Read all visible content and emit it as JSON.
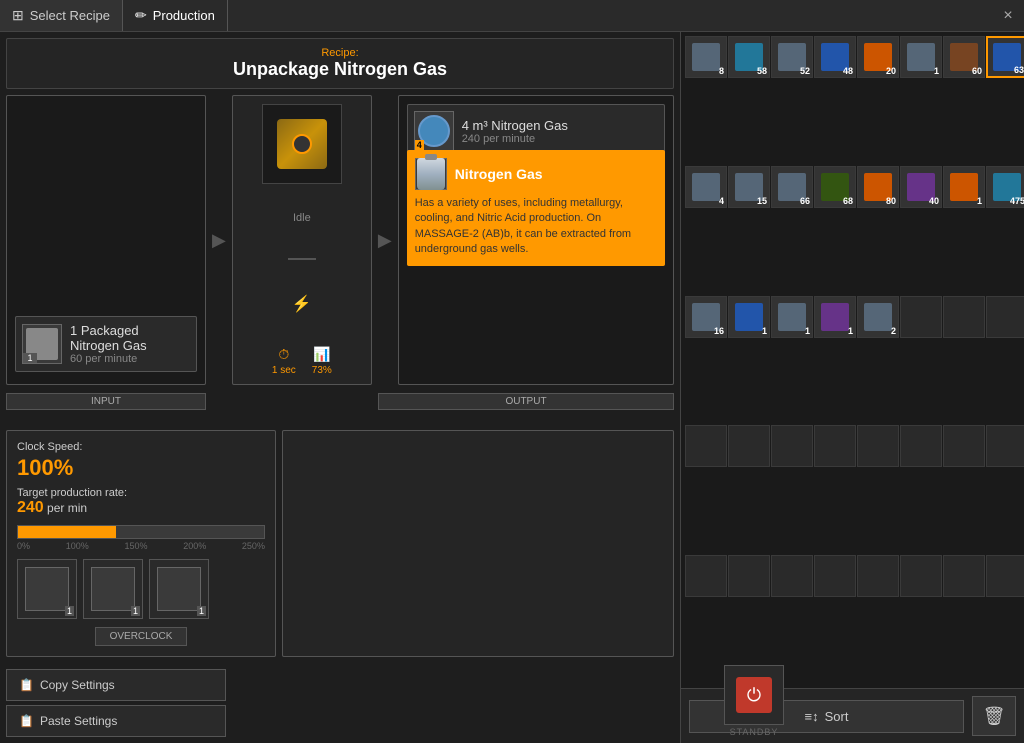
{
  "titlebar": {
    "tab1_label": "Select Recipe",
    "tab2_label": "Production",
    "close_label": "×"
  },
  "recipe": {
    "label": "Recipe:",
    "name": "Unpackage Nitrogen Gas"
  },
  "input": {
    "label": "INPUT",
    "item_name": "1 Packaged Nitrogen Gas",
    "item_rate": "60 per minute",
    "item_badge": "1"
  },
  "machine": {
    "status": "Idle",
    "time": "1 sec",
    "efficiency": "73%"
  },
  "output": {
    "label": "OUTPUT",
    "item_name": "4 m³ Nitrogen Gas",
    "item_rate": "240 per minute",
    "item_badge": "4",
    "tooltip_title": "Nitrogen Gas",
    "tooltip_desc": "Has a variety of uses, including metallurgy, cooling, and Nitric Acid production. On MASSAGE-2 (AB)b, it can be extracted from underground gas wells."
  },
  "clock": {
    "speed_label": "Clock Speed:",
    "speed_value": "100%",
    "target_label": "Target production rate:",
    "target_value": "240",
    "target_unit": "per min",
    "overclock_label": "OVERCLOCK"
  },
  "progress_markers": [
    "0%",
    "100%",
    "150%",
    "200%",
    "250%"
  ],
  "mini_slots": [
    {
      "badge": "1"
    },
    {
      "badge": "1"
    },
    {
      "badge": "1"
    }
  ],
  "settings": {
    "copy_label": "Copy Settings",
    "paste_label": "Paste Settings"
  },
  "standby": {
    "label": "STANDBY"
  },
  "sort": {
    "label": "Sort"
  },
  "inventory": {
    "slots": [
      {
        "count": "8",
        "color": "gray",
        "has_item": true
      },
      {
        "count": "58",
        "color": "cyan",
        "has_item": true
      },
      {
        "count": "52",
        "color": "gray",
        "has_item": true
      },
      {
        "count": "48",
        "color": "blue",
        "has_item": true
      },
      {
        "count": "20",
        "color": "orange",
        "has_item": true
      },
      {
        "count": "1",
        "color": "gray",
        "has_item": true
      },
      {
        "count": "60",
        "color": "brown",
        "has_item": true
      },
      {
        "count": "63",
        "color": "blue",
        "has_item": true,
        "selected": true
      },
      {
        "count": "4",
        "color": "gray",
        "has_item": true
      },
      {
        "count": "15",
        "color": "gray",
        "has_item": true
      },
      {
        "count": "66",
        "color": "gray",
        "has_item": true
      },
      {
        "count": "68",
        "color": "green",
        "has_item": true
      },
      {
        "count": "80",
        "color": "orange",
        "has_item": true
      },
      {
        "count": "40",
        "color": "purple",
        "has_item": true
      },
      {
        "count": "1",
        "color": "orange",
        "has_item": true
      },
      {
        "count": "475",
        "color": "cyan",
        "has_item": true
      },
      {
        "count": "16",
        "color": "gray",
        "has_item": true
      },
      {
        "count": "1",
        "color": "blue",
        "has_item": true
      },
      {
        "count": "1",
        "color": "gray",
        "has_item": true
      },
      {
        "count": "1",
        "color": "purple",
        "has_item": true
      },
      {
        "count": "2",
        "color": "gray",
        "has_item": true
      },
      {
        "count": "",
        "color": "gray",
        "has_item": false
      },
      {
        "count": "",
        "color": "gray",
        "has_item": false
      },
      {
        "count": "",
        "color": "gray",
        "has_item": false
      },
      {
        "count": "",
        "color": "gray",
        "has_item": false
      },
      {
        "count": "",
        "color": "gray",
        "has_item": false
      },
      {
        "count": "",
        "color": "gray",
        "has_item": false
      },
      {
        "count": "",
        "color": "gray",
        "has_item": false
      },
      {
        "count": "",
        "color": "gray",
        "has_item": false
      },
      {
        "count": "",
        "color": "gray",
        "has_item": false
      },
      {
        "count": "",
        "color": "gray",
        "has_item": false
      },
      {
        "count": "",
        "color": "gray",
        "has_item": false
      },
      {
        "count": "",
        "color": "gray",
        "has_item": false
      },
      {
        "count": "",
        "color": "gray",
        "has_item": false
      },
      {
        "count": "",
        "color": "gray",
        "has_item": false
      },
      {
        "count": "",
        "color": "gray",
        "has_item": false
      },
      {
        "count": "",
        "color": "gray",
        "has_item": false
      },
      {
        "count": "",
        "color": "gray",
        "has_item": false
      },
      {
        "count": "",
        "color": "gray",
        "has_item": false
      },
      {
        "count": "",
        "color": "gray",
        "has_item": false
      }
    ]
  }
}
